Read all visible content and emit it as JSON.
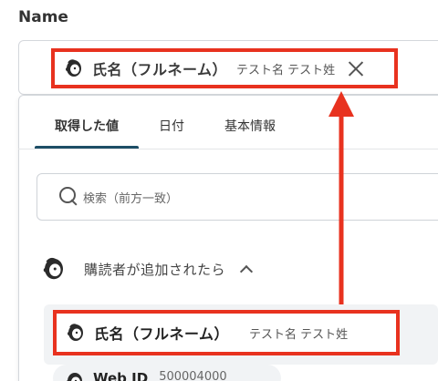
{
  "field": {
    "label": "Name"
  },
  "selected_chip": {
    "name": "氏名（フルネーム）",
    "sample": "テスト名 テスト姓",
    "icon": "mailchimp-icon"
  },
  "tabs": [
    {
      "label": "取得した値",
      "active": true
    },
    {
      "label": "日付",
      "active": false
    },
    {
      "label": "基本情報",
      "active": false
    }
  ],
  "search": {
    "placeholder": "検索（前方一致）"
  },
  "group": {
    "title": "購読者が追加されたら",
    "icon": "mailchimp-icon"
  },
  "items": [
    {
      "name": "氏名（フルネーム）",
      "sample": "テスト名 テスト姓",
      "icon": "mailchimp-icon"
    },
    {
      "name": "Web ID",
      "sample": "500004000",
      "icon": "mailchimp-icon"
    }
  ],
  "colors": {
    "highlight": "#e8321f",
    "tab_active": "#1d4e66"
  }
}
